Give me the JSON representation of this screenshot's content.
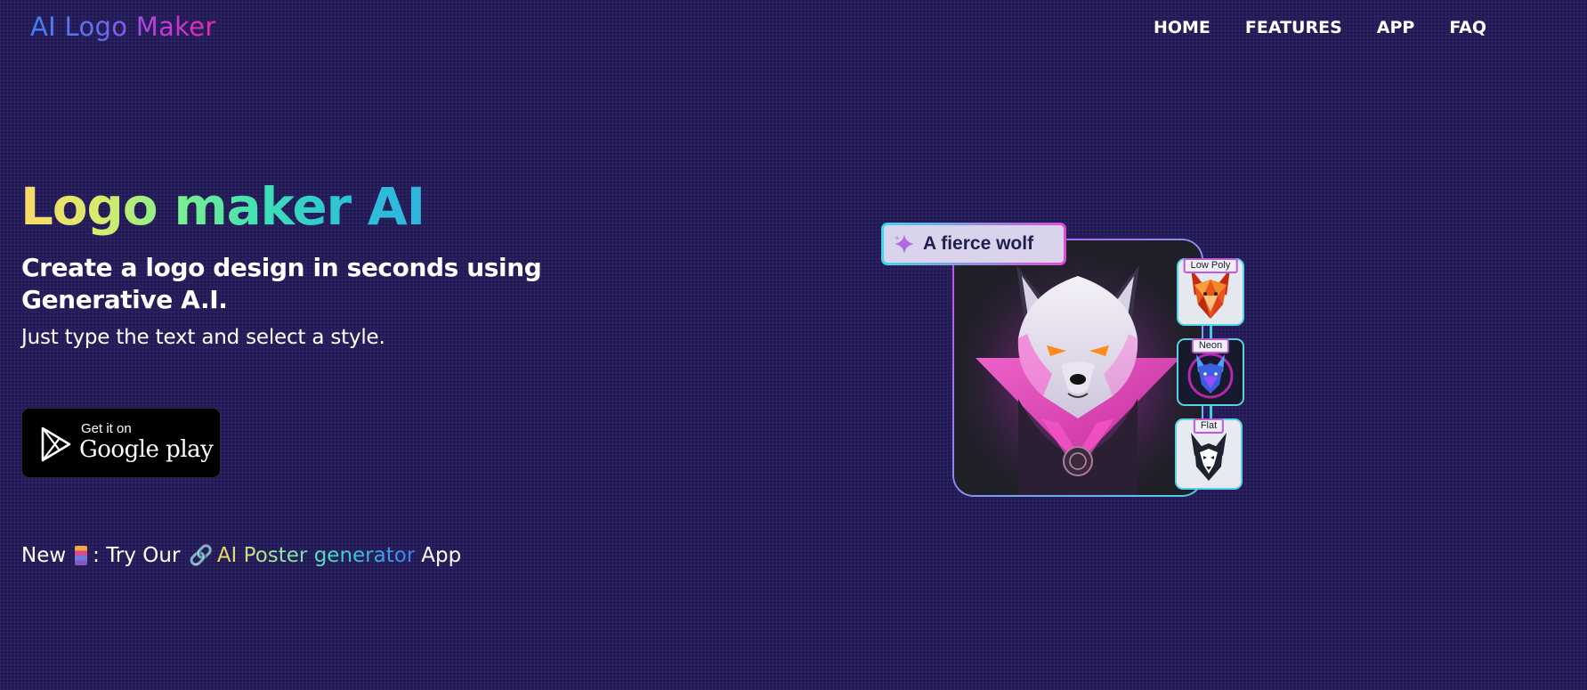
{
  "brand": {
    "text": "AI Logo Maker"
  },
  "nav": {
    "items": [
      "HOME",
      "FEATURES",
      "APP",
      "FAQ"
    ]
  },
  "hero": {
    "title": "Logo maker AI",
    "subtitle": "Create a logo design in seconds using Generative A.I.",
    "description": "Just type the text and select a style."
  },
  "store_badge": {
    "small_text": "Get it on",
    "big_text": "Google play"
  },
  "promo": {
    "new_label": "New",
    "try_text": ": Try Our",
    "link_text": "AI Poster generator",
    "suffix": "App"
  },
  "illustration": {
    "prompt": "A fierce wolf",
    "styles": [
      "Low Poly",
      "Neon",
      "Flat"
    ]
  },
  "colors": {
    "background": "#221957",
    "title_gradient": [
      "#fbd86a",
      "#7ff08e",
      "#2fb3df"
    ],
    "brand_gradient": [
      "#3f82f3",
      "#e62aa8"
    ]
  }
}
